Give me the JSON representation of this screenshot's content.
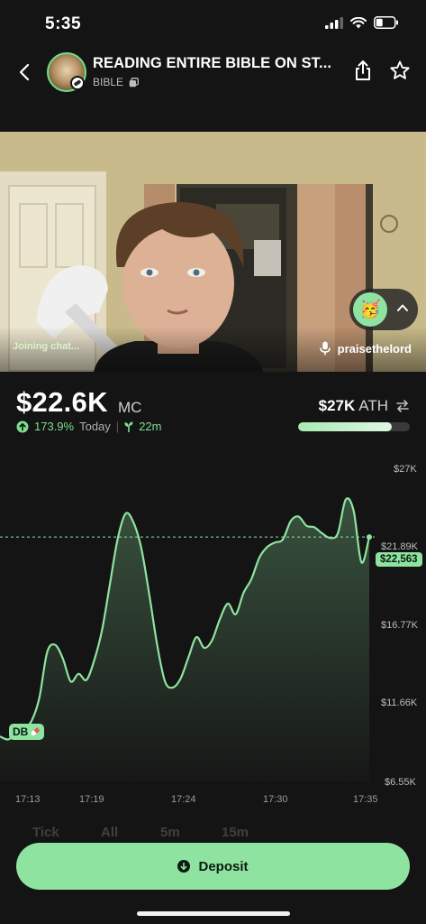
{
  "status_bar": {
    "time": "5:35"
  },
  "header": {
    "title": "READING ENTIRE BIBLE ON ST...",
    "ticker": "BIBLE"
  },
  "stream": {
    "joining_text": "Joining chat...",
    "streamer_name": "praisethelord",
    "reaction_emoji": "🥳"
  },
  "stats": {
    "market_cap": "$22.6K",
    "market_cap_unit": "MC",
    "change_pct": "173.9%",
    "change_period": "Today",
    "age": "22m",
    "ath_value": "$27K",
    "ath_label": "ATH",
    "ath_progress": 0.84
  },
  "chart_data": {
    "type": "area",
    "y_ticks": [
      "$27K",
      "$21.89K",
      "$16.77K",
      "$11.66K",
      "$6.55K"
    ],
    "x_ticks": [
      "17:13",
      "17:19",
      "17:24",
      "17:30",
      "17:35"
    ],
    "ylim": [
      6550,
      27000
    ],
    "current_price_label": "$22,563",
    "current_price": 22563,
    "dev_buy_tag": "DB",
    "series": [
      {
        "values": [
          9500,
          9300,
          9600,
          10000,
          10500,
          12000,
          15000,
          15500,
          14600,
          13100,
          13600,
          13200,
          14500,
          16500,
          19500,
          22500,
          24100,
          23500,
          21800,
          18800,
          15500,
          13100,
          12700,
          13300,
          14700,
          16000,
          15300,
          15800,
          17200,
          18200,
          17500,
          18900,
          19800,
          21200,
          21900,
          22200,
          22400,
          23600,
          23900,
          23300,
          23200,
          22800,
          22500,
          22800,
          25000,
          24300,
          20900,
          22563
        ],
        "color": "#8fe3a0"
      }
    ]
  },
  "footer": {
    "faded_tabs": [
      "Tick",
      "All",
      "5m",
      "15m"
    ],
    "deposit_label": "Deposit"
  },
  "colors": {
    "accent": "#8fe3a0",
    "positive": "#7be08e",
    "background": "#141414"
  }
}
